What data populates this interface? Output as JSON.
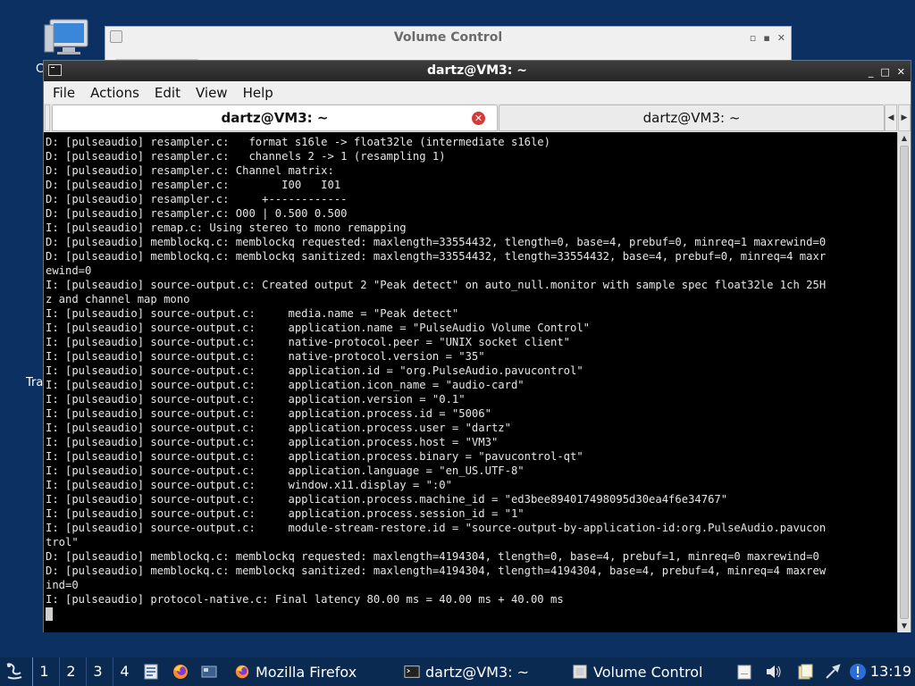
{
  "desktop": {
    "label_frag_computer": "C",
    "label_frag_trash": "Tra"
  },
  "volume_window": {
    "title": "Volume Control",
    "buttons": [
      "▫",
      "▪",
      "✕"
    ]
  },
  "terminal_window": {
    "title": "dartz@VM3: ~",
    "window_buttons": [
      "_",
      "□",
      "✕"
    ],
    "menu": [
      "File",
      "Actions",
      "Edit",
      "View",
      "Help"
    ],
    "tabs": [
      {
        "label": "dartz@VM3: ~",
        "active": true
      },
      {
        "label": "dartz@VM3: ~",
        "active": false
      }
    ],
    "tab_close_symbol": "✕",
    "lines": [
      "D: [pulseaudio] resampler.c:   format s16le -> float32le (intermediate s16le)",
      "D: [pulseaudio] resampler.c:   channels 2 -> 1 (resampling 1)",
      "D: [pulseaudio] resampler.c: Channel matrix:",
      "D: [pulseaudio] resampler.c:        I00   I01",
      "D: [pulseaudio] resampler.c:     +------------",
      "D: [pulseaudio] resampler.c: O00 | 0.500 0.500",
      "I: [pulseaudio] remap.c: Using stereo to mono remapping",
      "D: [pulseaudio] memblockq.c: memblockq requested: maxlength=33554432, tlength=0, base=4, prebuf=0, minreq=1 maxrewind=0",
      "D: [pulseaudio] memblockq.c: memblockq sanitized: maxlength=33554432, tlength=33554432, base=4, prebuf=0, minreq=4 maxr",
      "ewind=0",
      "I: [pulseaudio] source-output.c: Created output 2 \"Peak detect\" on auto_null.monitor with sample spec float32le 1ch 25H",
      "z and channel map mono",
      "I: [pulseaudio] source-output.c:     media.name = \"Peak detect\"",
      "I: [pulseaudio] source-output.c:     application.name = \"PulseAudio Volume Control\"",
      "I: [pulseaudio] source-output.c:     native-protocol.peer = \"UNIX socket client\"",
      "I: [pulseaudio] source-output.c:     native-protocol.version = \"35\"",
      "I: [pulseaudio] source-output.c:     application.id = \"org.PulseAudio.pavucontrol\"",
      "I: [pulseaudio] source-output.c:     application.icon_name = \"audio-card\"",
      "I: [pulseaudio] source-output.c:     application.version = \"0.1\"",
      "I: [pulseaudio] source-output.c:     application.process.id = \"5006\"",
      "I: [pulseaudio] source-output.c:     application.process.user = \"dartz\"",
      "I: [pulseaudio] source-output.c:     application.process.host = \"VM3\"",
      "I: [pulseaudio] source-output.c:     application.process.binary = \"pavucontrol-qt\"",
      "I: [pulseaudio] source-output.c:     application.language = \"en_US.UTF-8\"",
      "I: [pulseaudio] source-output.c:     window.x11.display = \":0\"",
      "I: [pulseaudio] source-output.c:     application.process.machine_id = \"ed3bee894017498095d30ea4f6e34767\"",
      "I: [pulseaudio] source-output.c:     application.process.session_id = \"1\"",
      "I: [pulseaudio] source-output.c:     module-stream-restore.id = \"source-output-by-application-id:org.PulseAudio.pavucon",
      "trol\"",
      "D: [pulseaudio] memblockq.c: memblockq requested: maxlength=4194304, tlength=0, base=4, prebuf=1, minreq=0 maxrewind=0",
      "D: [pulseaudio] memblockq.c: memblockq sanitized: maxlength=4194304, tlength=4194304, base=4, prebuf=4, minreq=4 maxrew",
      "ind=0",
      "I: [pulseaudio] protocol-native.c: Final latency 80.00 ms = 40.00 ms + 40.00 ms"
    ]
  },
  "taskbar": {
    "workspaces": [
      "1",
      "2",
      "3",
      "4"
    ],
    "tasks": [
      {
        "label": "Mozilla Firefox",
        "icon": "firefox-icon"
      },
      {
        "label": "dartz@VM3: ~",
        "icon": "terminal-icon"
      },
      {
        "label": "Volume Control",
        "icon": "volume-control-icon"
      }
    ],
    "clock": "13:19"
  }
}
